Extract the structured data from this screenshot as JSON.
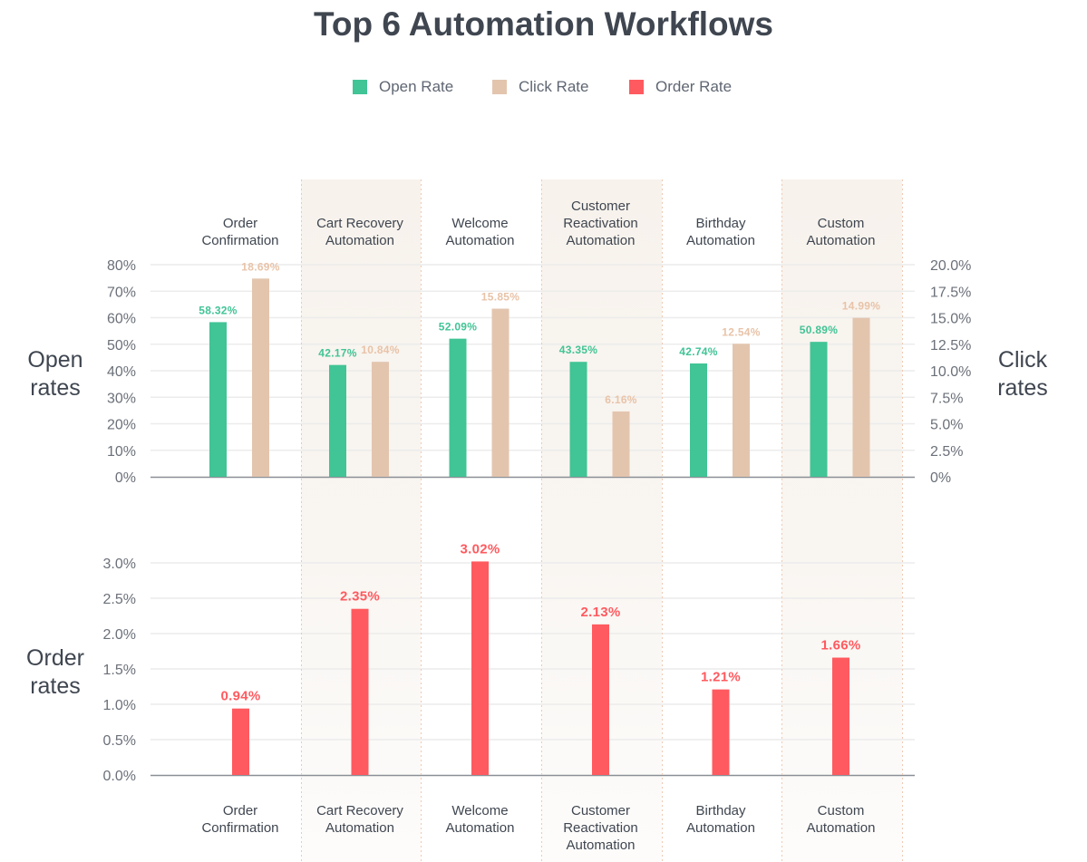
{
  "chart_data": {
    "type": "bar",
    "title": "Top 6 Automation Workflows",
    "legend": {
      "position": "top-center",
      "entries": [
        {
          "name": "Open Rate",
          "color": "#41c496"
        },
        {
          "name": "Click Rate",
          "color": "#e3c5ae"
        },
        {
          "name": "Order Rate",
          "color": "#ff5a5f"
        }
      ]
    },
    "categories": [
      [
        "Order",
        "Confirmation"
      ],
      [
        "Cart Recovery",
        "Automation"
      ],
      [
        "Welcome",
        "Automation"
      ],
      [
        "Customer",
        "Reactivation",
        "Automation"
      ],
      [
        "Birthday",
        "Automation"
      ],
      [
        "Custom",
        "Automation"
      ]
    ],
    "shaded_columns": [
      1,
      3,
      5
    ],
    "panels": [
      {
        "name": "top",
        "left_axis": {
          "label": [
            "Open",
            "rates"
          ],
          "range": [
            0,
            80
          ],
          "ticks": [
            "0%",
            "10%",
            "20%",
            "30%",
            "40%",
            "50%",
            "60%",
            "70%",
            "80%"
          ]
        },
        "right_axis": {
          "label": [
            "Click",
            "rates"
          ],
          "range": [
            0,
            20
          ],
          "ticks": [
            "0%",
            "2.5%",
            "5.0%",
            "7.5%",
            "10.0%",
            "12.5%",
            "15.0%",
            "17.5%",
            "20.0%"
          ]
        },
        "series": [
          {
            "name": "Open Rate",
            "axis": "left",
            "color": "#41c496",
            "values": [
              58.32,
              42.17,
              52.09,
              43.35,
              42.74,
              50.89
            ],
            "labels": [
              "58.32%",
              "42.17%",
              "52.09%",
              "43.35%",
              "42.74%",
              "50.89%"
            ]
          },
          {
            "name": "Click Rate",
            "axis": "right",
            "color": "#e3c5ae",
            "values": [
              18.69,
              10.84,
              15.85,
              6.16,
              12.54,
              14.99
            ],
            "labels": [
              "18.69%",
              "10.84%",
              "15.85%",
              "6.16%",
              "12.54%",
              "14.99%"
            ]
          }
        ]
      },
      {
        "name": "bottom",
        "left_axis": {
          "label": [
            "Order",
            "rates"
          ],
          "range": [
            0,
            3
          ],
          "ticks": [
            "0.0%",
            "0.5%",
            "1.0%",
            "1.5%",
            "2.0%",
            "2.5%",
            "3.0%"
          ]
        },
        "series": [
          {
            "name": "Order Rate",
            "axis": "left",
            "color": "#ff5a5f",
            "values": [
              0.94,
              2.35,
              3.02,
              2.13,
              1.21,
              1.66
            ],
            "labels": [
              "0.94%",
              "2.35%",
              "3.02%",
              "2.13%",
              "1.21%",
              "1.66%"
            ]
          }
        ]
      }
    ],
    "grid": true
  }
}
